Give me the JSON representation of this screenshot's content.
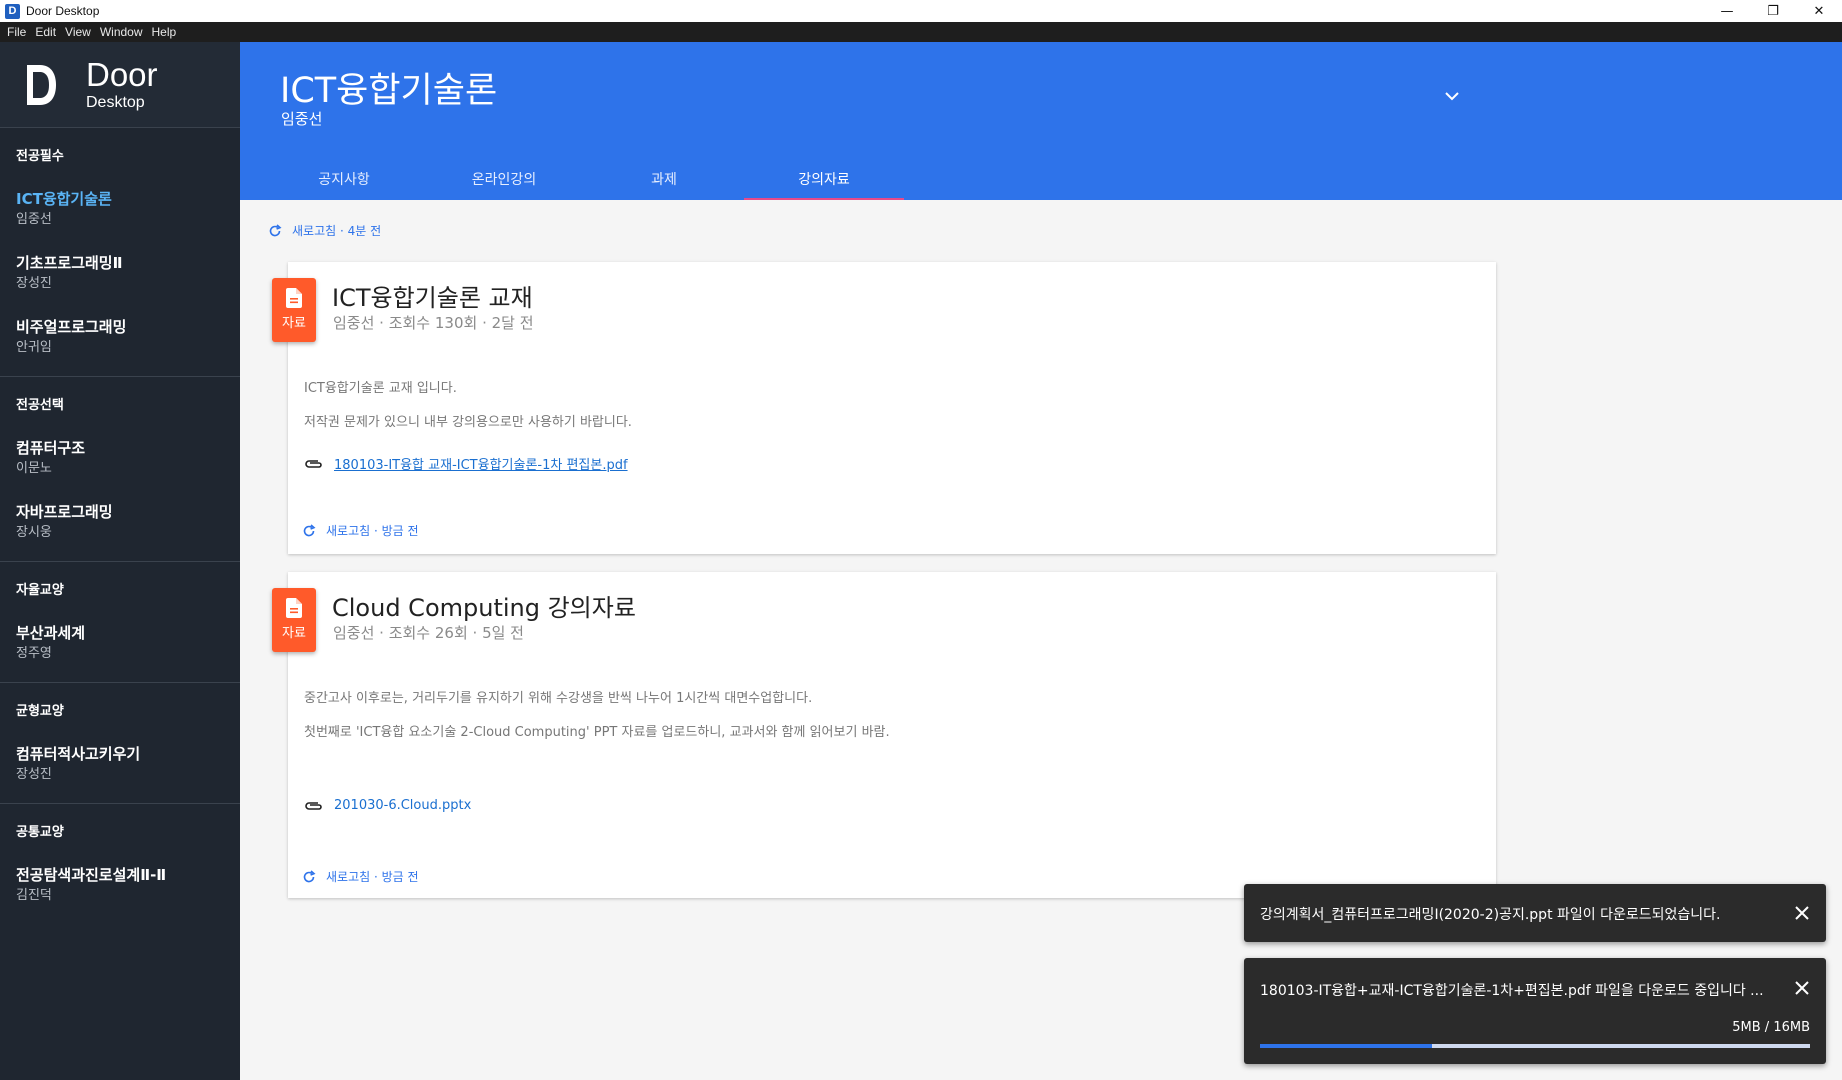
{
  "window": {
    "title": "Door Desktop",
    "app_icon_letter": "D",
    "minimize_glyph": "—",
    "maximize_glyph": "❐",
    "close_glyph": "✕"
  },
  "menu": [
    "File",
    "Edit",
    "View",
    "Window",
    "Help"
  ],
  "brand": {
    "name": "Door",
    "sub": "Desktop"
  },
  "sidebar": {
    "sections": [
      {
        "title": "전공필수",
        "courses": [
          {
            "name": "ICT융합기술론",
            "prof": "임중선",
            "active": true
          },
          {
            "name": "기초프로그래밍Ⅱ",
            "prof": "장성진"
          },
          {
            "name": "비주얼프로그래밍",
            "prof": "안귀임"
          }
        ]
      },
      {
        "title": "전공선택",
        "courses": [
          {
            "name": "컴퓨터구조",
            "prof": "이문노"
          },
          {
            "name": "자바프로그래밍",
            "prof": "장시웅"
          }
        ]
      },
      {
        "title": "자율교양",
        "courses": [
          {
            "name": "부산과세계",
            "prof": "정주영"
          }
        ]
      },
      {
        "title": "균형교양",
        "courses": [
          {
            "name": "컴퓨터적사고키우기",
            "prof": "장성진"
          }
        ]
      },
      {
        "title": "공통교양",
        "courses": [
          {
            "name": "전공탐색과진로설계Ⅱ-Ⅱ",
            "prof": "김진덕"
          }
        ]
      }
    ]
  },
  "header": {
    "title": "ICT융합기술론",
    "professor": "임중선",
    "tabs": [
      {
        "label": "공지사항"
      },
      {
        "label": "온라인강의"
      },
      {
        "label": "과제"
      },
      {
        "label": "강의자료",
        "active": true
      }
    ]
  },
  "main": {
    "refresh_label": "새로고침 · 4분 전",
    "posts": [
      {
        "badge": "자료",
        "title": "ICT융합기술론 교재",
        "meta": "임중선 · 조회수 130회 · 2달 전",
        "body": [
          "ICT융합기술론 교재 입니다.",
          "저작권 문제가 있으니 내부 강의용으로만 사용하기 바랍니다."
        ],
        "attachment": "180103-IT융합 교재-ICT융합기술론-1차 편집본.pdf",
        "refresh": "새로고침 · 방금 전"
      },
      {
        "badge": "자료",
        "title": "Cloud Computing 강의자료",
        "meta": "임중선 · 조회수 26회 · 5일 전",
        "body": [
          "중간고사 이후로는, 거리두기를 유지하기 위해 수강생을 반씩 나누어 1시간씩 대면수업합니다.",
          "첫번째로 'ICT융합 요소기술 2-Cloud Computing' PPT 자료를 업로드하니, 교과서와 함께 읽어보기 바람."
        ],
        "attachment": "201030-6.Cloud.pptx",
        "refresh": "새로고침 · 방금 전"
      }
    ]
  },
  "toasts": [
    {
      "message": "강의계획서_컴퓨터프로그래밍I(2020-2)공지.ppt 파일이 다운로드되었습니다."
    },
    {
      "message": "180103-IT융합+교재-ICT융합기술론-1차+편집본.pdf 파일을 다운로드 중입니다 ...",
      "size": "5MB / 16MB",
      "progress": 0.3125
    }
  ],
  "colors": {
    "header": "#2e73ea",
    "sidebar": "#1f2630",
    "badge": "#ff5a2a",
    "active_course": "#5ab4f5",
    "tab_indicator": "#e84a8a"
  },
  "icons": {
    "file": "file-icon",
    "refresh": "refresh-icon",
    "attach": "paperclip-icon",
    "close": "close-icon",
    "chevron": "chevron-down-icon"
  }
}
